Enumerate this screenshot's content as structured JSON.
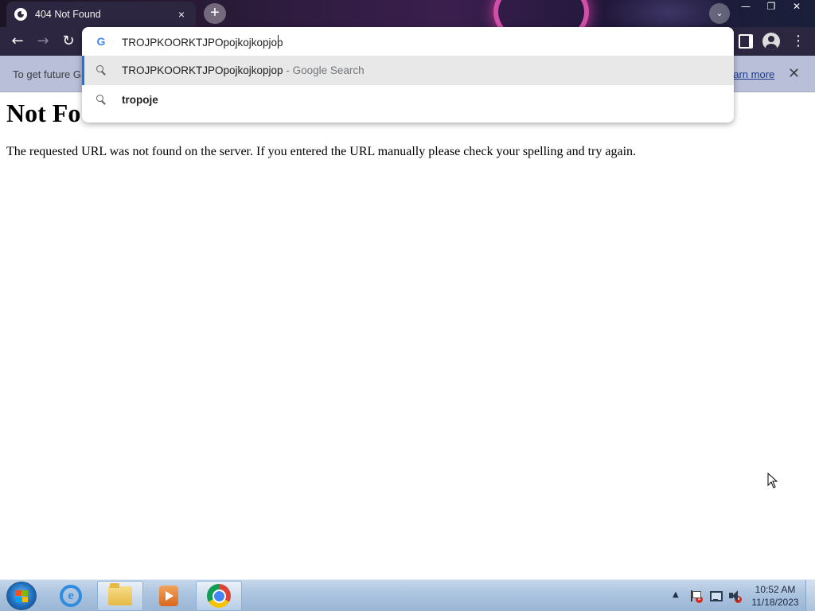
{
  "browser": {
    "tab": {
      "title": "404 Not Found",
      "close_icon": "×"
    },
    "new_tab_icon": "+",
    "tab_search_icon": "⌄",
    "window_controls": {
      "minimize": "—",
      "restore": "❐",
      "close": "✕"
    },
    "nav": {
      "back": "←",
      "forward": "→",
      "reload": "↻",
      "menu": "⋮"
    },
    "omnibox": {
      "input_value": "TROJPKOORKTJPOpojkojkopjop",
      "google_icon": "G",
      "suggestions": [
        {
          "text": "TROJPKOORKTJPOpojkojkopjop",
          "subtext": " - Google Search",
          "icon": "search-icon",
          "selected": true
        },
        {
          "text": "tropoje",
          "subtext": "",
          "icon": "search-icon",
          "selected": false
        }
      ]
    },
    "infobar": {
      "text": "To get future G",
      "link": "earn more",
      "close_icon": "✕"
    }
  },
  "page": {
    "heading": "Not Fo",
    "message": "The requested URL was not found on the server. If you entered the URL manually please check your spelling and try again."
  },
  "taskbar": {
    "pinned": [
      "internet-explorer",
      "windows-explorer",
      "media-player",
      "google-chrome"
    ],
    "active": "google-chrome",
    "tray_arrow": "▲",
    "clock": {
      "time": "10:52 AM",
      "date": "11/18/2023"
    }
  },
  "colors": {
    "frame": "#2c2640",
    "infobar": "#b9bfd8",
    "selected_suggestion": "#e8e8e8",
    "taskbar": "#a9c2de"
  }
}
